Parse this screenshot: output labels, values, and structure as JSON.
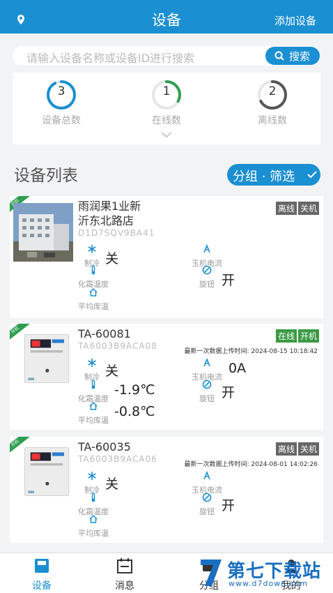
{
  "header": {
    "title": "设备",
    "add_label": "添加设备"
  },
  "search": {
    "placeholder": "请输入设备名称或设备ID进行搜索",
    "button_label": "搜索"
  },
  "stats": [
    {
      "value": "3",
      "label": "设备总数",
      "ring_fraction": 0.92,
      "color": "#1a8fd1"
    },
    {
      "value": "1",
      "label": "在线数",
      "ring_fraction": 0.33,
      "color": "#2e9e4f"
    },
    {
      "value": "2",
      "label": "离线数",
      "ring_fraction": 0.67,
      "color": "#555555"
    }
  ],
  "list": {
    "title": "设备列表",
    "filter_label": "分组 · 筛选"
  },
  "devices": [
    {
      "name_line1": "雨润果1业新",
      "name_line2": "沂东北路店",
      "device_id": "D1D7SQV9BA41",
      "status": "离线",
      "power": "关机",
      "status_color": "gray",
      "ribbon": "开机",
      "cooling_label": "制冷",
      "cooling_value": "关",
      "current_label": "玉机电流",
      "current_value": "",
      "knob_label": "旋钮",
      "knob_value": "开",
      "defrost_label": "化霜温度",
      "defrost_value": "",
      "avg_label": "平均库温",
      "avg_value": "",
      "upload": ""
    },
    {
      "name_line1": "TA-60081",
      "name_line2": "",
      "device_id": "TA6003B9ACA08",
      "status": "在线",
      "power": "开机",
      "status_color": "green",
      "ribbon": "开机",
      "cooling_label": "制冷",
      "cooling_value": "关",
      "current_label": "玉机电流",
      "current_value": "0A",
      "knob_label": "旋钮",
      "knob_value": "开",
      "defrost_label": "化霜温度",
      "defrost_value": "-1.9℃",
      "avg_label": "平均库温",
      "avg_value": "-0.8℃",
      "upload": "最新一次数据上传时间: 2024-08-15 10:18:42"
    },
    {
      "name_line1": "TA-60035",
      "name_line2": "",
      "device_id": "TA6003B9ACA06",
      "status": "离线",
      "power": "关机",
      "status_color": "gray",
      "ribbon": "开机",
      "cooling_label": "制冷",
      "cooling_value": "关",
      "current_label": "玉机电流",
      "current_value": "",
      "knob_label": "旋钮",
      "knob_value": "开",
      "defrost_label": "化霜温度",
      "defrost_value": "",
      "avg_label": "平均库温",
      "avg_value": "",
      "upload": "最新一次数据上传时间: 2024-08-01 14:02:26"
    }
  ],
  "tabbar": {
    "items": [
      "设备",
      "消息",
      "分组",
      "我的"
    ],
    "active_color": "#1a8fd1"
  },
  "watermark": {
    "brand": "第七下载站",
    "url": "www.d7down.com"
  }
}
